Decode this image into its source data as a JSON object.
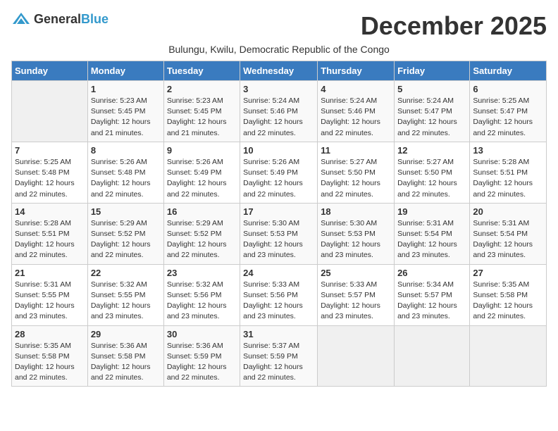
{
  "header": {
    "logo_general": "General",
    "logo_blue": "Blue",
    "month_title": "December 2025",
    "subtitle": "Bulungu, Kwilu, Democratic Republic of the Congo"
  },
  "days_of_week": [
    "Sunday",
    "Monday",
    "Tuesday",
    "Wednesday",
    "Thursday",
    "Friday",
    "Saturday"
  ],
  "weeks": [
    [
      {
        "day": "",
        "sunrise": "",
        "sunset": "",
        "daylight": ""
      },
      {
        "day": "1",
        "sunrise": "Sunrise: 5:23 AM",
        "sunset": "Sunset: 5:45 PM",
        "daylight": "Daylight: 12 hours and 21 minutes."
      },
      {
        "day": "2",
        "sunrise": "Sunrise: 5:23 AM",
        "sunset": "Sunset: 5:45 PM",
        "daylight": "Daylight: 12 hours and 21 minutes."
      },
      {
        "day": "3",
        "sunrise": "Sunrise: 5:24 AM",
        "sunset": "Sunset: 5:46 PM",
        "daylight": "Daylight: 12 hours and 22 minutes."
      },
      {
        "day": "4",
        "sunrise": "Sunrise: 5:24 AM",
        "sunset": "Sunset: 5:46 PM",
        "daylight": "Daylight: 12 hours and 22 minutes."
      },
      {
        "day": "5",
        "sunrise": "Sunrise: 5:24 AM",
        "sunset": "Sunset: 5:47 PM",
        "daylight": "Daylight: 12 hours and 22 minutes."
      },
      {
        "day": "6",
        "sunrise": "Sunrise: 5:25 AM",
        "sunset": "Sunset: 5:47 PM",
        "daylight": "Daylight: 12 hours and 22 minutes."
      }
    ],
    [
      {
        "day": "7",
        "sunrise": "Sunrise: 5:25 AM",
        "sunset": "Sunset: 5:48 PM",
        "daylight": "Daylight: 12 hours and 22 minutes."
      },
      {
        "day": "8",
        "sunrise": "Sunrise: 5:26 AM",
        "sunset": "Sunset: 5:48 PM",
        "daylight": "Daylight: 12 hours and 22 minutes."
      },
      {
        "day": "9",
        "sunrise": "Sunrise: 5:26 AM",
        "sunset": "Sunset: 5:49 PM",
        "daylight": "Daylight: 12 hours and 22 minutes."
      },
      {
        "day": "10",
        "sunrise": "Sunrise: 5:26 AM",
        "sunset": "Sunset: 5:49 PM",
        "daylight": "Daylight: 12 hours and 22 minutes."
      },
      {
        "day": "11",
        "sunrise": "Sunrise: 5:27 AM",
        "sunset": "Sunset: 5:50 PM",
        "daylight": "Daylight: 12 hours and 22 minutes."
      },
      {
        "day": "12",
        "sunrise": "Sunrise: 5:27 AM",
        "sunset": "Sunset: 5:50 PM",
        "daylight": "Daylight: 12 hours and 22 minutes."
      },
      {
        "day": "13",
        "sunrise": "Sunrise: 5:28 AM",
        "sunset": "Sunset: 5:51 PM",
        "daylight": "Daylight: 12 hours and 22 minutes."
      }
    ],
    [
      {
        "day": "14",
        "sunrise": "Sunrise: 5:28 AM",
        "sunset": "Sunset: 5:51 PM",
        "daylight": "Daylight: 12 hours and 22 minutes."
      },
      {
        "day": "15",
        "sunrise": "Sunrise: 5:29 AM",
        "sunset": "Sunset: 5:52 PM",
        "daylight": "Daylight: 12 hours and 22 minutes."
      },
      {
        "day": "16",
        "sunrise": "Sunrise: 5:29 AM",
        "sunset": "Sunset: 5:52 PM",
        "daylight": "Daylight: 12 hours and 22 minutes."
      },
      {
        "day": "17",
        "sunrise": "Sunrise: 5:30 AM",
        "sunset": "Sunset: 5:53 PM",
        "daylight": "Daylight: 12 hours and 23 minutes."
      },
      {
        "day": "18",
        "sunrise": "Sunrise: 5:30 AM",
        "sunset": "Sunset: 5:53 PM",
        "daylight": "Daylight: 12 hours and 23 minutes."
      },
      {
        "day": "19",
        "sunrise": "Sunrise: 5:31 AM",
        "sunset": "Sunset: 5:54 PM",
        "daylight": "Daylight: 12 hours and 23 minutes."
      },
      {
        "day": "20",
        "sunrise": "Sunrise: 5:31 AM",
        "sunset": "Sunset: 5:54 PM",
        "daylight": "Daylight: 12 hours and 23 minutes."
      }
    ],
    [
      {
        "day": "21",
        "sunrise": "Sunrise: 5:31 AM",
        "sunset": "Sunset: 5:55 PM",
        "daylight": "Daylight: 12 hours and 23 minutes."
      },
      {
        "day": "22",
        "sunrise": "Sunrise: 5:32 AM",
        "sunset": "Sunset: 5:55 PM",
        "daylight": "Daylight: 12 hours and 23 minutes."
      },
      {
        "day": "23",
        "sunrise": "Sunrise: 5:32 AM",
        "sunset": "Sunset: 5:56 PM",
        "daylight": "Daylight: 12 hours and 23 minutes."
      },
      {
        "day": "24",
        "sunrise": "Sunrise: 5:33 AM",
        "sunset": "Sunset: 5:56 PM",
        "daylight": "Daylight: 12 hours and 23 minutes."
      },
      {
        "day": "25",
        "sunrise": "Sunrise: 5:33 AM",
        "sunset": "Sunset: 5:57 PM",
        "daylight": "Daylight: 12 hours and 23 minutes."
      },
      {
        "day": "26",
        "sunrise": "Sunrise: 5:34 AM",
        "sunset": "Sunset: 5:57 PM",
        "daylight": "Daylight: 12 hours and 23 minutes."
      },
      {
        "day": "27",
        "sunrise": "Sunrise: 5:35 AM",
        "sunset": "Sunset: 5:58 PM",
        "daylight": "Daylight: 12 hours and 22 minutes."
      }
    ],
    [
      {
        "day": "28",
        "sunrise": "Sunrise: 5:35 AM",
        "sunset": "Sunset: 5:58 PM",
        "daylight": "Daylight: 12 hours and 22 minutes."
      },
      {
        "day": "29",
        "sunrise": "Sunrise: 5:36 AM",
        "sunset": "Sunset: 5:58 PM",
        "daylight": "Daylight: 12 hours and 22 minutes."
      },
      {
        "day": "30",
        "sunrise": "Sunrise: 5:36 AM",
        "sunset": "Sunset: 5:59 PM",
        "daylight": "Daylight: 12 hours and 22 minutes."
      },
      {
        "day": "31",
        "sunrise": "Sunrise: 5:37 AM",
        "sunset": "Sunset: 5:59 PM",
        "daylight": "Daylight: 12 hours and 22 minutes."
      },
      {
        "day": "",
        "sunrise": "",
        "sunset": "",
        "daylight": ""
      },
      {
        "day": "",
        "sunrise": "",
        "sunset": "",
        "daylight": ""
      },
      {
        "day": "",
        "sunrise": "",
        "sunset": "",
        "daylight": ""
      }
    ]
  ]
}
